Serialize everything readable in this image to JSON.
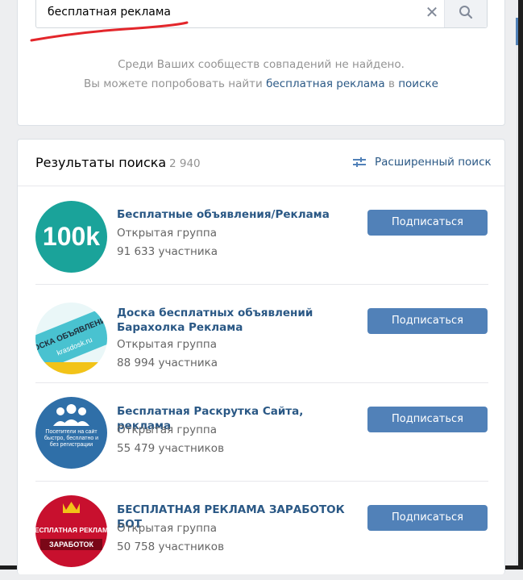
{
  "search": {
    "value": "бесплатная реклама",
    "clear_symbol": "✕"
  },
  "not_found": {
    "line1": "Среди Ваших сообществ совпадений не найдено.",
    "line2_prefix": "Вы можете попробовать найти",
    "line2_query": "бесплатная реклама",
    "line2_middle": "в",
    "line2_link": "поиске"
  },
  "results": {
    "title": "Результаты поиска",
    "count": "2 940",
    "advanced_search": "Расширенный поиск",
    "groups": [
      {
        "name": "Бесплатные объявления/Реклама",
        "type": "Открытая группа",
        "members": "91 633 участника",
        "button": "Подписаться",
        "avatar": {
          "text": "100k",
          "color": "#1aa39a"
        }
      },
      {
        "name": "Доска бесплатных объявлений Барахолка Реклама",
        "type": "Открытая группа",
        "members": "88 994 участника",
        "button": "Подписаться",
        "avatar": {
          "text": "ДОСКА ОБЪЯВЛЕНИЙ",
          "subtext": "krasdosk.ru",
          "color": "#49c2d0"
        }
      },
      {
        "name": "Бесплатная Раскрутка Сайта, реклама",
        "type": "Открытая группа",
        "members": "55 479 участников",
        "button": "Подписаться",
        "avatar": {
          "text": "Посетители на сайт быстро, бесплатно и без регистрации",
          "color": "#2f6fa8"
        }
      },
      {
        "name": "БЕСПЛАТНАЯ РЕКЛАМА ЗАРАБОТОК БОТ",
        "type": "Открытая группа",
        "members": "50 758 участников",
        "button": "Подписаться",
        "avatar": {
          "text": "БЕСПЛАТНАЯ РЕКЛАМА",
          "subtext": "ЗАРАБОТОК",
          "color": "#c8102e"
        }
      }
    ]
  },
  "colors": {
    "link": "#2a5885",
    "button": "#5181b8",
    "muted": "#939393",
    "annotation": "#e3262b"
  }
}
